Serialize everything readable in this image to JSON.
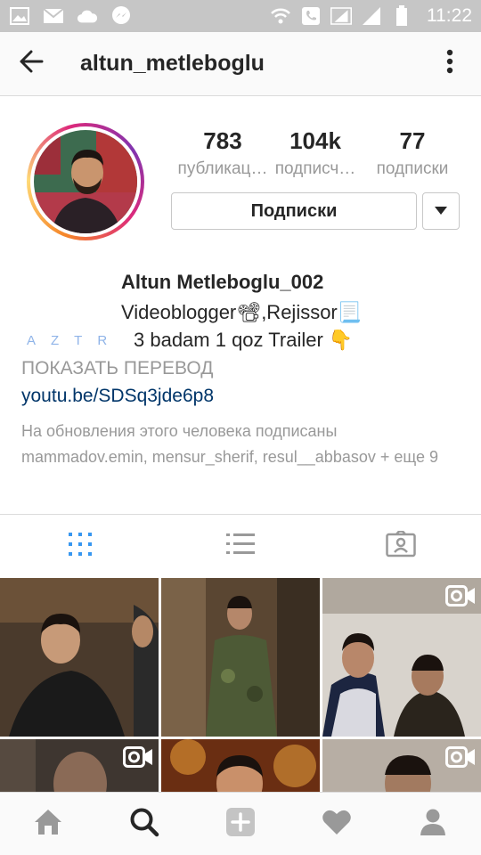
{
  "status_bar": {
    "time": "11:22",
    "left_icons": [
      "image-icon",
      "mail-icon",
      "cloud-icon",
      "messenger-icon"
    ],
    "right_icons": [
      "wifi-icon",
      "phone-icon",
      "signal-icon",
      "signal-icon",
      "battery-icon"
    ]
  },
  "header": {
    "username": "altun_metleboglu",
    "back_icon": "arrow-left-icon",
    "more_icon": "vertical-dots-icon"
  },
  "profile": {
    "stats": [
      {
        "value": "783",
        "label": "публикац…"
      },
      {
        "value": "104k",
        "label": "подписч…"
      },
      {
        "value": "77",
        "label": "подписки"
      }
    ],
    "follow_button_label": "Подписки",
    "full_name": "Altun Metleboglu_002",
    "bio_line1": "Videoblogger📽,Rejissor📃",
    "bio_prefix": "AZTR",
    "bio_line2": "3 badam 1 qoz Trailer 👇",
    "show_translation": "ПОКАЗАТЬ ПЕРЕВОД",
    "website": "youtu.be/SDSq3jde6p8",
    "followed_by": "На обновления этого человека подписаны mammadov.emin, mensur_sherif, resul__abbasov + еще 9"
  },
  "tabs": [
    {
      "name": "grid",
      "icon": "grid-icon",
      "active": true
    },
    {
      "name": "list",
      "icon": "list-icon",
      "active": false
    },
    {
      "name": "tagged",
      "icon": "tagged-icon",
      "active": false
    }
  ],
  "nav": [
    "home-icon",
    "search-icon",
    "add-icon",
    "heart-icon",
    "profile-icon"
  ],
  "colors": {
    "accent_blue": "#3897f0",
    "link": "#003569",
    "muted": "#999999",
    "status_bar": "#c6c6c6"
  }
}
